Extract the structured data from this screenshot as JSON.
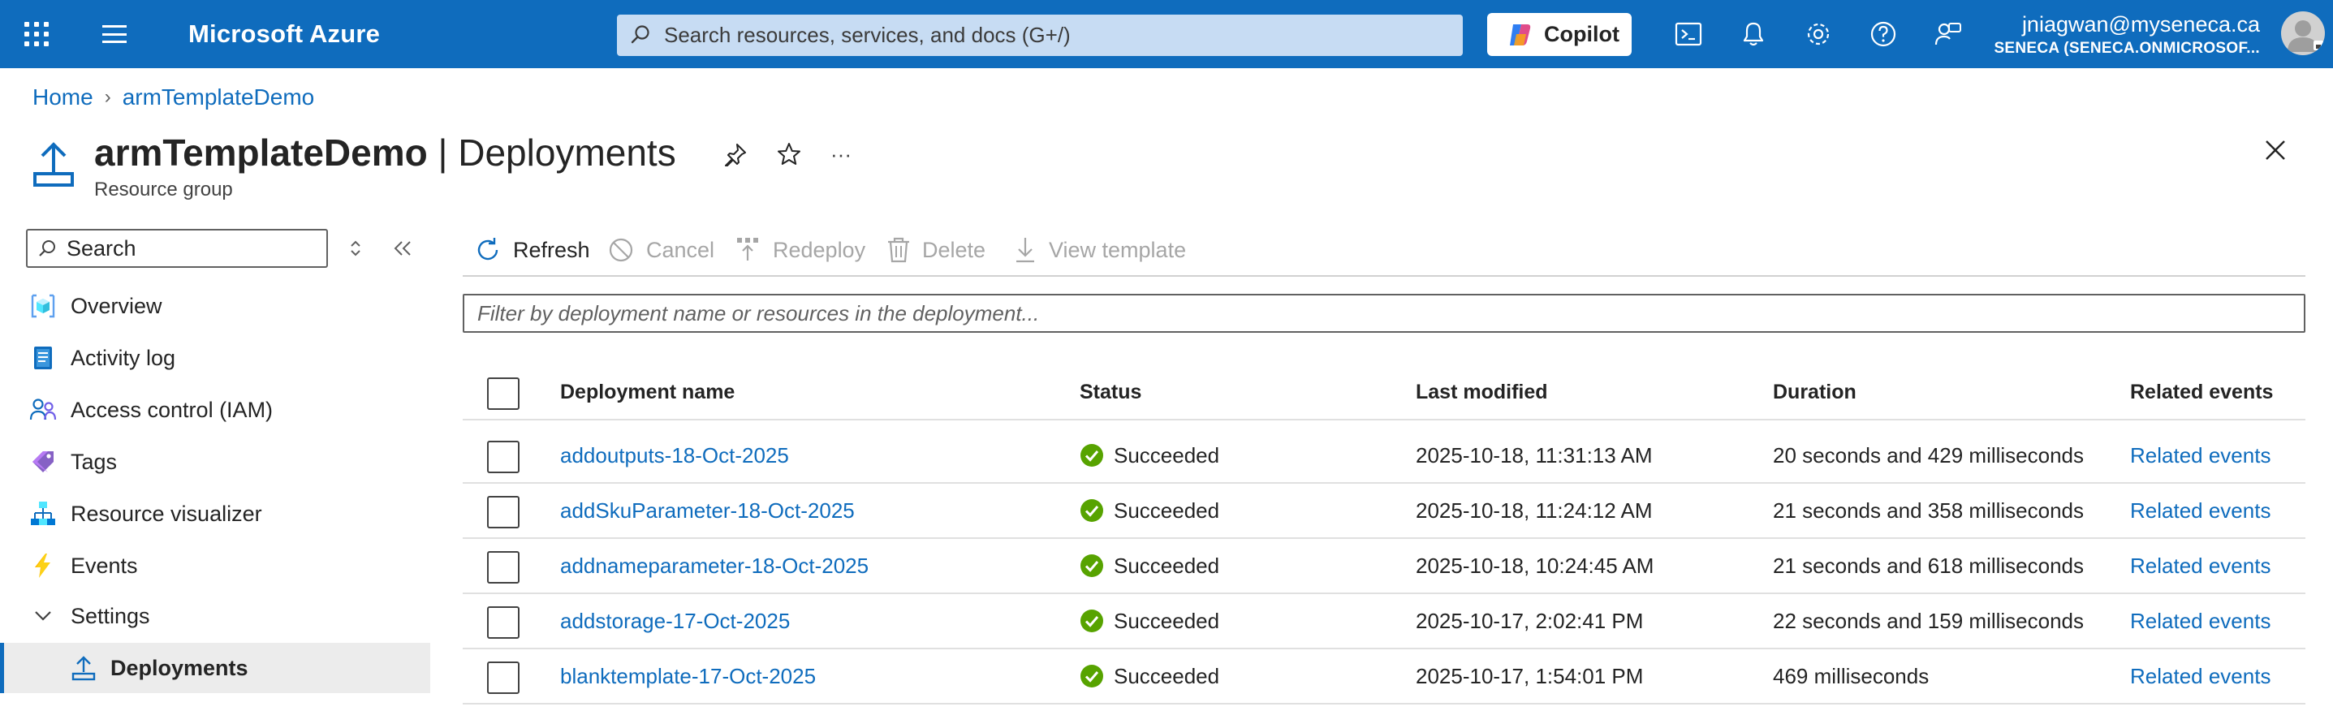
{
  "topbar": {
    "brand": "Microsoft Azure",
    "search_placeholder": "Search resources, services, and docs (G+/)",
    "copilot_label": "Copilot",
    "account_email": "jniagwan@myseneca.ca",
    "account_tenant": "SENECA (SENECA.ONMICROSOF..."
  },
  "breadcrumb": {
    "items": [
      "Home",
      "armTemplateDemo"
    ]
  },
  "header": {
    "resource_name": "armTemplateDemo",
    "separator": " | ",
    "page_name": "Deployments",
    "subtitle": "Resource group",
    "more_label": "···"
  },
  "sidebar": {
    "search_placeholder": "Search",
    "items": [
      {
        "label": "Overview",
        "icon": "resource-group-cube-icon"
      },
      {
        "label": "Activity log",
        "icon": "activity-log-icon"
      },
      {
        "label": "Access control (IAM)",
        "icon": "people-icon"
      },
      {
        "label": "Tags",
        "icon": "tag-icon"
      },
      {
        "label": "Resource visualizer",
        "icon": "network-icon"
      },
      {
        "label": "Events",
        "icon": "lightning-icon"
      },
      {
        "label": "Settings",
        "icon": "chevron-down-icon"
      },
      {
        "label": "Deployments",
        "icon": "upload-icon"
      }
    ]
  },
  "toolbar": {
    "refresh": "Refresh",
    "cancel": "Cancel",
    "redeploy": "Redeploy",
    "delete": "Delete",
    "view_template": "View template"
  },
  "filter": {
    "placeholder": "Filter by deployment name or resources in the deployment..."
  },
  "table": {
    "headers": {
      "name": "Deployment name",
      "status": "Status",
      "modified": "Last modified",
      "duration": "Duration",
      "events": "Related events"
    },
    "rows": [
      {
        "name": "addoutputs-18-Oct-2025",
        "status": "Succeeded",
        "modified": "2025-10-18, 11:31:13 AM",
        "duration": "20 seconds and 429 milliseconds",
        "events": "Related events"
      },
      {
        "name": "addSkuParameter-18-Oct-2025",
        "status": "Succeeded",
        "modified": "2025-10-18, 11:24:12 AM",
        "duration": "21 seconds and 358 milliseconds",
        "events": "Related events"
      },
      {
        "name": "addnameparameter-18-Oct-2025",
        "status": "Succeeded",
        "modified": "2025-10-18, 10:24:45 AM",
        "duration": "21 seconds and 618 milliseconds",
        "events": "Related events"
      },
      {
        "name": "addstorage-17-Oct-2025",
        "status": "Succeeded",
        "modified": "2025-10-17, 2:02:41 PM",
        "duration": "22 seconds and 159 milliseconds",
        "events": "Related events"
      },
      {
        "name": "blanktemplate-17-Oct-2025",
        "status": "Succeeded",
        "modified": "2025-10-17, 1:54:01 PM",
        "duration": "469 milliseconds",
        "events": "Related events"
      }
    ]
  },
  "colors": {
    "azure_blue": "#0f6cbd",
    "success_green": "#57a300"
  }
}
